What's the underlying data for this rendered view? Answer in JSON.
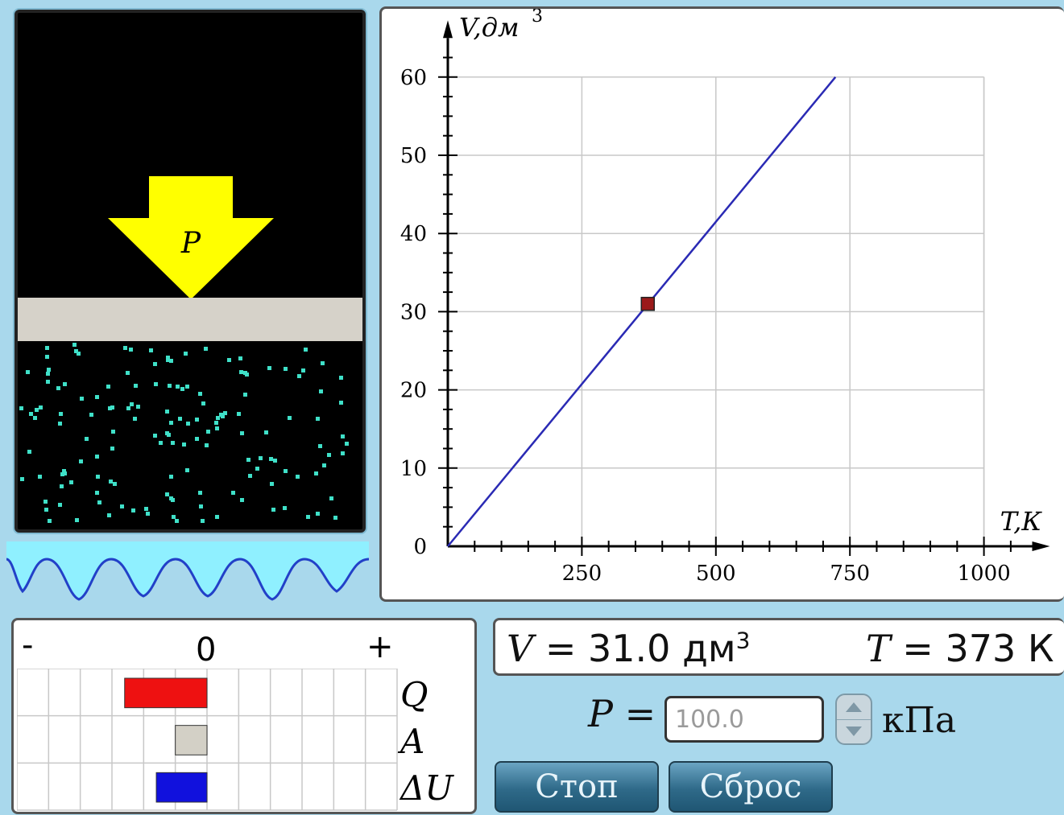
{
  "simulation": {
    "arrow_label": "P",
    "colors": {
      "arrow": "#ffff00",
      "piston": "#d6d2c9",
      "gas_particle": "#3fe0c8",
      "heater": "#8ff0ff"
    }
  },
  "chart_data": {
    "type": "line",
    "x_axis_label": "T,К",
    "y_axis_label": "V,дм",
    "y_axis_label_sup": "3",
    "xlim": [
      0,
      1100
    ],
    "ylim": [
      0,
      65
    ],
    "x_ticks": [
      250,
      500,
      750,
      1000
    ],
    "y_ticks": [
      0,
      10,
      20,
      30,
      40,
      50,
      60
    ],
    "grid": true,
    "series": [
      {
        "x": [
          0,
          723
        ],
        "y": [
          0,
          60
        ],
        "color": "#2a2ab4"
      }
    ],
    "marker": {
      "x": 373,
      "y": 31.0,
      "color": "#9b1a1a"
    }
  },
  "energy_bars": {
    "minus_label": "-",
    "zero_label": "0",
    "plus_label": "+",
    "rows": [
      {
        "label": "Q",
        "value": -2.6,
        "color": "#ee1111"
      },
      {
        "label": "A",
        "value": -1.0,
        "color": "#d3d0c6"
      },
      {
        "label": "ΔU",
        "value": -1.6,
        "color": "#1111dd"
      }
    ]
  },
  "readout": {
    "volume_symbol": "V",
    "volume_text": " = 31.0 дм",
    "volume_sup": "3",
    "temperature_symbol": "T",
    "temperature_text": " = 373 К"
  },
  "pressure": {
    "symbol": "P",
    "eq": " =",
    "value": "100.0",
    "unit": "кПа"
  },
  "buttons": {
    "stop_label": "Стоп",
    "reset_label": "Сброс"
  }
}
